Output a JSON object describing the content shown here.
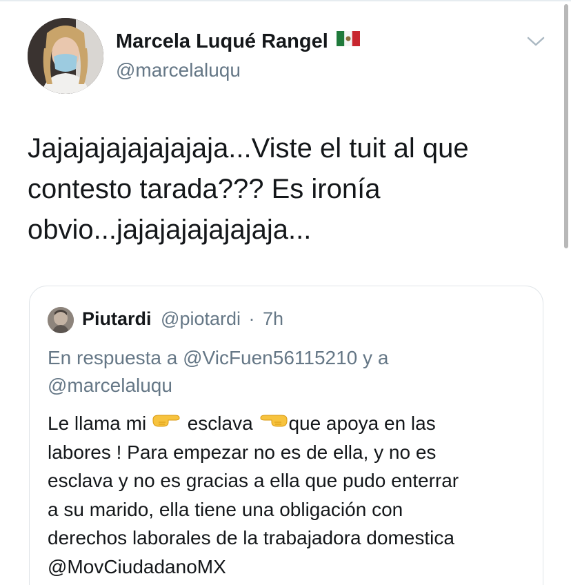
{
  "tweet": {
    "author": {
      "display_name": "Marcela Luqué Rangel",
      "handle": "@marcelaluqu",
      "flag_icon": "mexico-flag-icon"
    },
    "text_lines": [
      "Jajajajajajajajaja...Viste el tuit al que",
      "contesto tarada??? Es ironía",
      "obvio...jajajajajajajaja..."
    ],
    "menu_icon": "chevron-down-icon"
  },
  "quoted_tweet": {
    "display_name": "Piutardi",
    "handle": "@piotardi",
    "separator": "·",
    "time": "7h",
    "reply_lines": [
      "En respuesta a @VicFuen56115210 y a",
      "@marcelaluqu"
    ],
    "body": {
      "line1_part1": "Le llama mi ",
      "line1_part2": " esclava ",
      "line1_part3": "que apoya en las",
      "lines": [
        "labores !  Para empezar no es de ella, y no es",
        "esclava y no es gracias a ella que pudo enterrar",
        "a su marido, ella tiene una obligación con",
        "derechos laborales de la trabajadora domestica",
        "@MovCiudadanoMX"
      ]
    },
    "emoji_right": "backhand-index-pointing-right-emoji",
    "emoji_left": "backhand-index-pointing-left-emoji"
  },
  "colors": {
    "text": "#14171a",
    "secondary": "#657786",
    "border": "#dfe4e8"
  }
}
